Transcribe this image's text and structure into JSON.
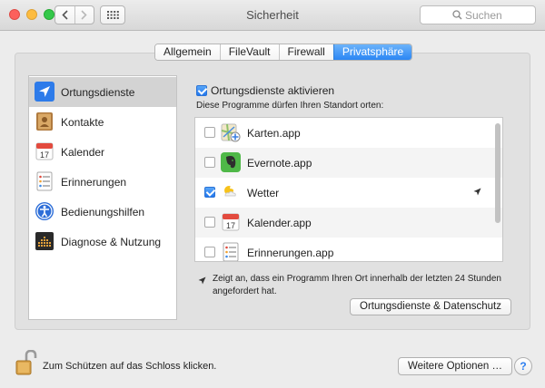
{
  "window": {
    "title": "Sicherheit"
  },
  "search": {
    "placeholder": "Suchen"
  },
  "tabs": [
    {
      "label": "Allgemein"
    },
    {
      "label": "FileVault"
    },
    {
      "label": "Firewall"
    },
    {
      "label": "Privatsphäre",
      "active": true
    }
  ],
  "sidebar": {
    "items": [
      {
        "label": "Ortungsdienste",
        "icon": "location-arrow-icon",
        "selected": true
      },
      {
        "label": "Kontakte",
        "icon": "contacts-book-icon"
      },
      {
        "label": "Kalender",
        "icon": "calendar-icon"
      },
      {
        "label": "Erinnerungen",
        "icon": "reminders-list-icon"
      },
      {
        "label": "Bedienungshilfen",
        "icon": "accessibility-icon"
      },
      {
        "label": "Diagnose & Nutzung",
        "icon": "diagnostics-grid-icon"
      }
    ]
  },
  "location": {
    "enable_label": "Ortungsdienste aktivieren",
    "enabled": true,
    "description": "Diese Programme dürfen Ihren Standort orten:",
    "apps": [
      {
        "name": "Karten.app",
        "checked": false,
        "icon": "maps-icon"
      },
      {
        "name": "Evernote.app",
        "checked": false,
        "icon": "evernote-icon"
      },
      {
        "name": "Wetter",
        "checked": true,
        "icon": "weather-icon",
        "recent": true
      },
      {
        "name": "Kalender.app",
        "checked": false,
        "icon": "calendar-icon"
      },
      {
        "name": "Erinnerungen.app",
        "checked": false,
        "icon": "reminders-list-icon"
      }
    ],
    "note": "Zeigt an, dass ein Programm Ihren Ort innerhalb der letzten 24 Stunden angefordert hat.",
    "privacy_button": "Ortungsdienste & Datenschutz"
  },
  "footer": {
    "lock_text": "Zum Schützen auf das Schloss klicken.",
    "more_options": "Weitere Optionen …",
    "help": "?"
  },
  "colors": {
    "accent": "#2b86f4",
    "selection": "#d3d3d3"
  }
}
